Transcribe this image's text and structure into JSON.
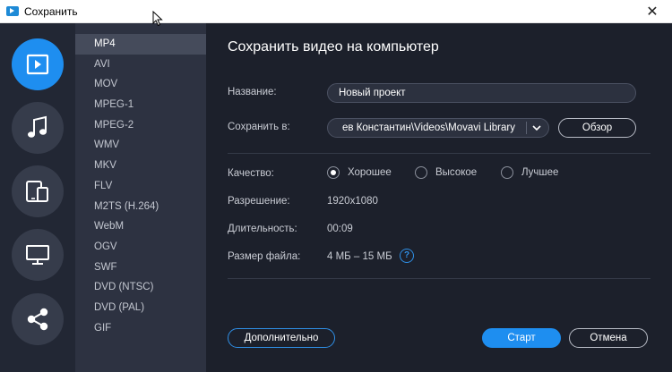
{
  "window": {
    "title": "Сохранить",
    "close_glyph": "✕"
  },
  "sidebar": {
    "items": [
      {
        "icon": "video-icon",
        "active": true
      },
      {
        "icon": "music-icon",
        "active": false
      },
      {
        "icon": "devices-icon",
        "active": false
      },
      {
        "icon": "monitor-icon",
        "active": false
      },
      {
        "icon": "share-icon",
        "active": false
      }
    ]
  },
  "formats": [
    "MP4",
    "AVI",
    "MOV",
    "MPEG-1",
    "MPEG-2",
    "WMV",
    "MKV",
    "FLV",
    "M2TS (H.264)",
    "WebM",
    "OGV",
    "SWF",
    "DVD (NTSC)",
    "DVD (PAL)",
    "GIF"
  ],
  "selected_format": "MP4",
  "main": {
    "heading": "Сохранить видео на компьютер",
    "name_label": "Название:",
    "name_value": "Новый проект",
    "save_label": "Сохранить в:",
    "save_path": "ев Константин\\Videos\\Movavi Library",
    "browse_label": "Обзор",
    "quality_label": "Качество:",
    "quality_options": [
      {
        "label": "Хорошее",
        "checked": true
      },
      {
        "label": "Высокое",
        "checked": false
      },
      {
        "label": "Лучшее",
        "checked": false
      }
    ],
    "resolution_label": "Разрешение:",
    "resolution_value": "1920x1080",
    "duration_label": "Длительность:",
    "duration_value": "00:09",
    "filesize_label": "Размер файла:",
    "filesize_value": "4 МБ – 15 МБ",
    "help_glyph": "?",
    "advanced_label": "Дополнительно",
    "start_label": "Старт",
    "cancel_label": "Отмена"
  },
  "colors": {
    "accent": "#1e8ef0",
    "panel": "#1c202b",
    "list": "#2d3241",
    "iconbar": "#222734"
  }
}
